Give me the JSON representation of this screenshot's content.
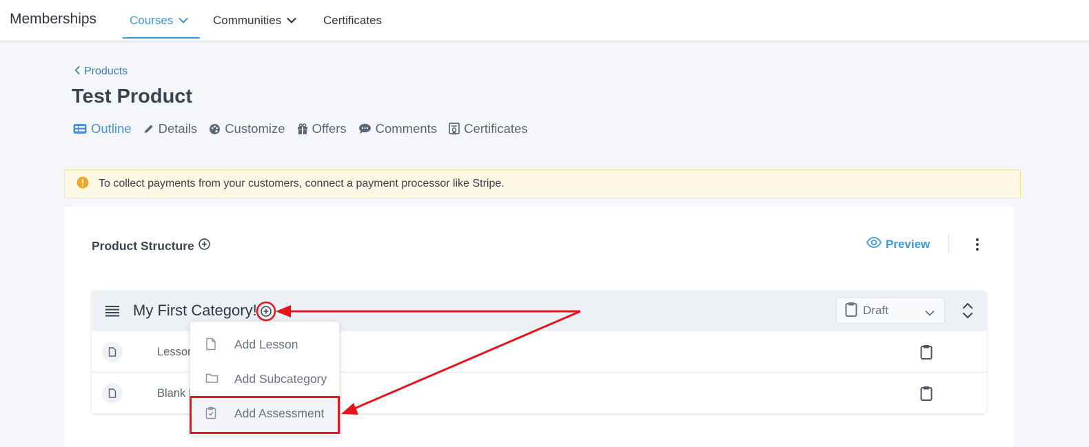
{
  "app": {
    "brand": "Memberships"
  },
  "topnav": {
    "tabs": [
      {
        "label": "Courses",
        "active": true
      },
      {
        "label": "Communities",
        "active": false
      },
      {
        "label": "Certificates",
        "active": false
      }
    ]
  },
  "breadcrumb": {
    "label": "Products"
  },
  "page": {
    "title": "Test Product"
  },
  "subtabs": [
    {
      "label": "Outline",
      "icon": "outline-icon",
      "active": true
    },
    {
      "label": "Details",
      "icon": "pencil-icon"
    },
    {
      "label": "Customize",
      "icon": "palette-icon"
    },
    {
      "label": "Offers",
      "icon": "gift-icon"
    },
    {
      "label": "Comments",
      "icon": "comment-icon"
    },
    {
      "label": "Certificates",
      "icon": "certificate-icon"
    }
  ],
  "alert": {
    "text": "To collect payments from your customers, connect a payment processor like Stripe.",
    "icon": "warning-icon",
    "color": "#f5a623"
  },
  "structure": {
    "title": "Product Structure",
    "preview_label": "Preview",
    "category": {
      "title": "My First Category!",
      "status": "Draft"
    },
    "rows": [
      {
        "label": "Lesson"
      },
      {
        "label": "Blank L"
      }
    ]
  },
  "menu": {
    "items": [
      {
        "label": "Add Lesson",
        "icon": "file-icon"
      },
      {
        "label": "Add Subcategory",
        "icon": "folder-icon"
      },
      {
        "label": "Add Assessment",
        "icon": "clipboard-check-icon"
      }
    ]
  },
  "colors": {
    "accent": "#3a9ad9",
    "annotation": "#e8141b"
  }
}
